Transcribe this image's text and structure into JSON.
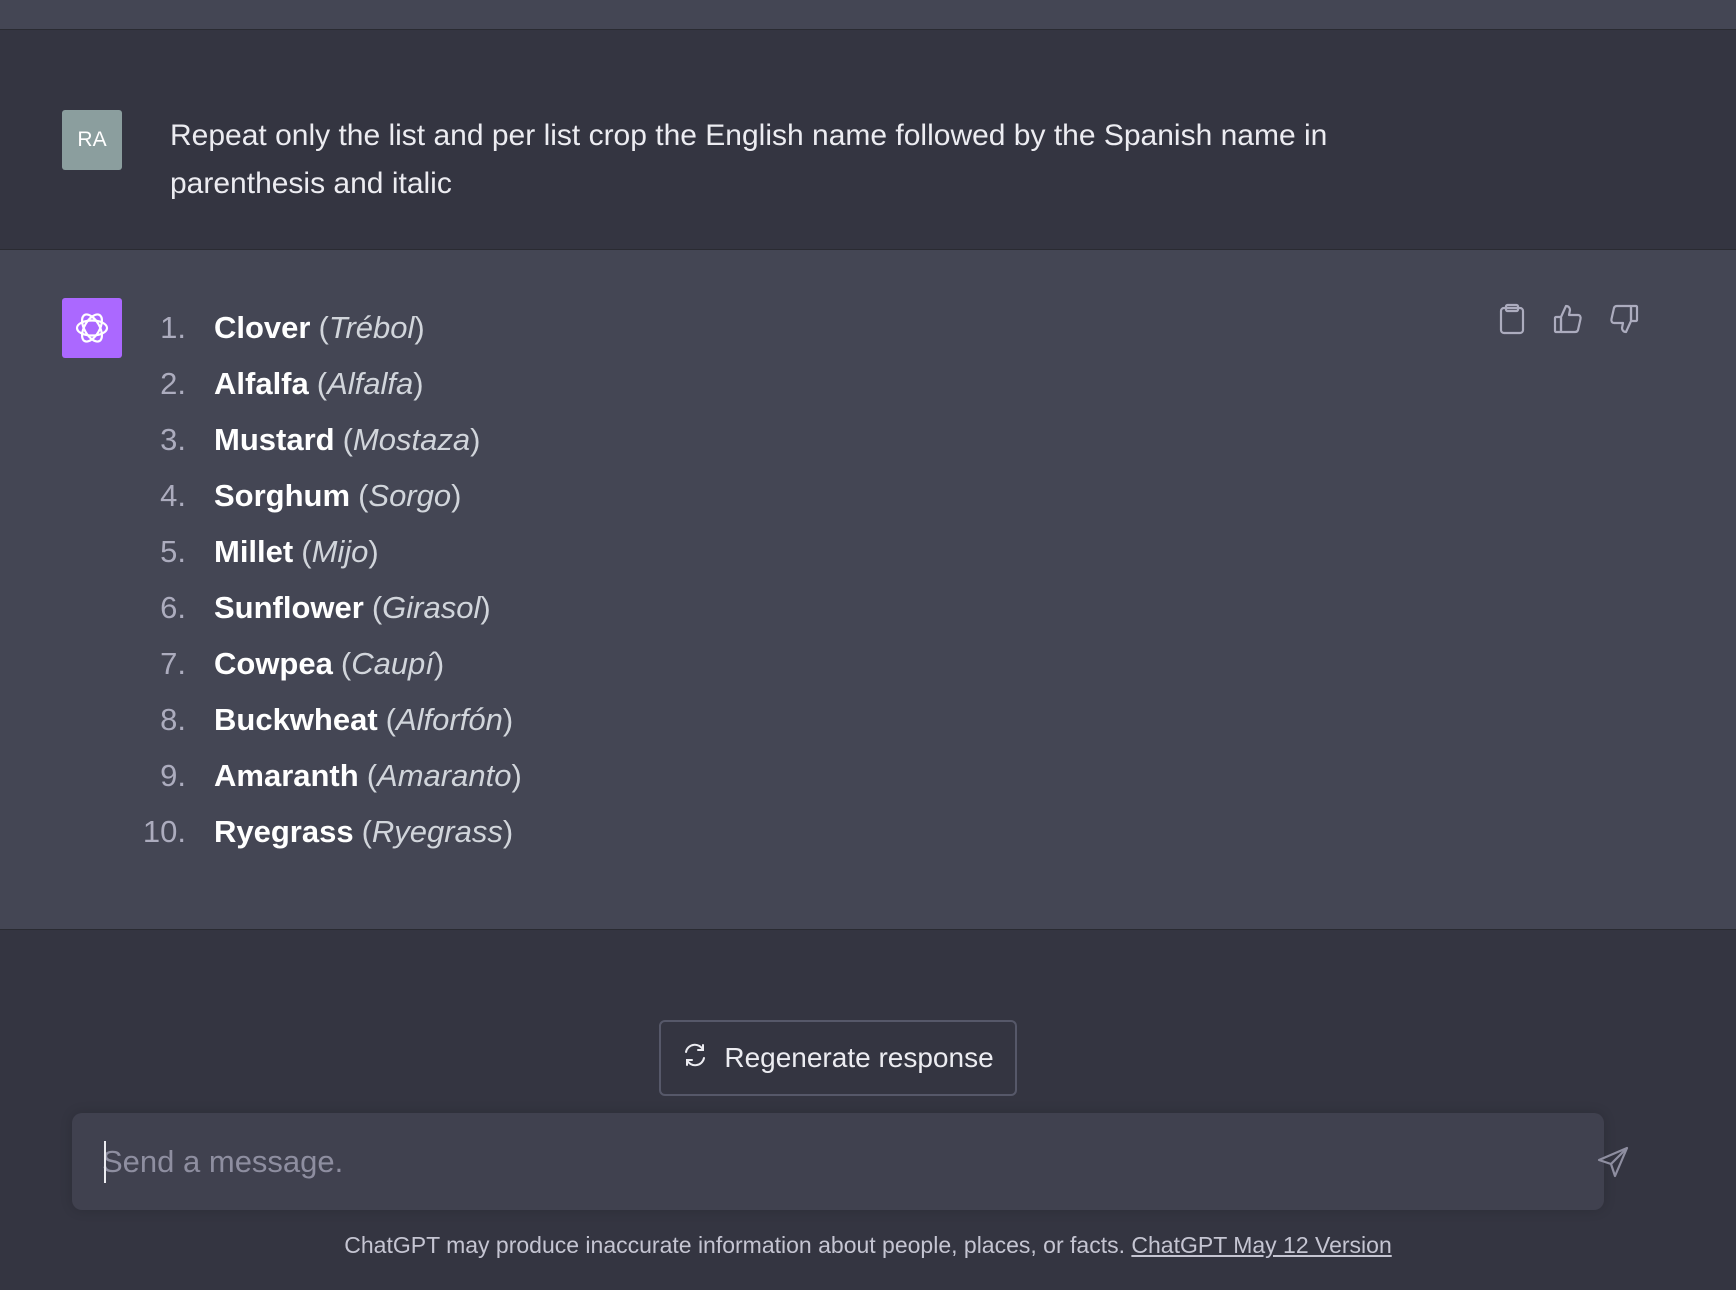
{
  "user_message": {
    "avatar_initials": "RA",
    "text": "Repeat only the list and per list crop the English name followed by the Spanish name in parenthesis and italic"
  },
  "assistant_message": {
    "avatar_icon": "openai-logo-icon",
    "items": [
      {
        "num": "1.",
        "english": "Clover",
        "spanish": "Trébol"
      },
      {
        "num": "2.",
        "english": "Alfalfa",
        "spanish": "Alfalfa"
      },
      {
        "num": "3.",
        "english": "Mustard",
        "spanish": "Mostaza"
      },
      {
        "num": "4.",
        "english": "Sorghum",
        "spanish": "Sorgo"
      },
      {
        "num": "5.",
        "english": "Millet",
        "spanish": "Mijo"
      },
      {
        "num": "6.",
        "english": "Sunflower",
        "spanish": "Girasol"
      },
      {
        "num": "7.",
        "english": "Cowpea",
        "spanish": "Caupí"
      },
      {
        "num": "8.",
        "english": "Buckwheat",
        "spanish": "Alforfón"
      },
      {
        "num": "9.",
        "english": "Amaranth",
        "spanish": "Amaranto"
      },
      {
        "num": "10.",
        "english": "Ryegrass",
        "spanish": "Ryegrass"
      }
    ],
    "actions": [
      "clipboard-icon",
      "thumbs-up-icon",
      "thumbs-down-icon"
    ]
  },
  "regenerate": {
    "label": "Regenerate response",
    "icon": "refresh-icon"
  },
  "composer": {
    "placeholder": "Send a message.",
    "send_icon": "send-icon"
  },
  "footer": {
    "text": "ChatGPT may produce inaccurate information about people, places, or facts. ",
    "link": "ChatGPT May 12 Version"
  },
  "colors": {
    "background": "#343541",
    "assistant_background": "#444654",
    "user_avatar": "#8b9e9e",
    "assistant_avatar": "#ab68ff"
  }
}
